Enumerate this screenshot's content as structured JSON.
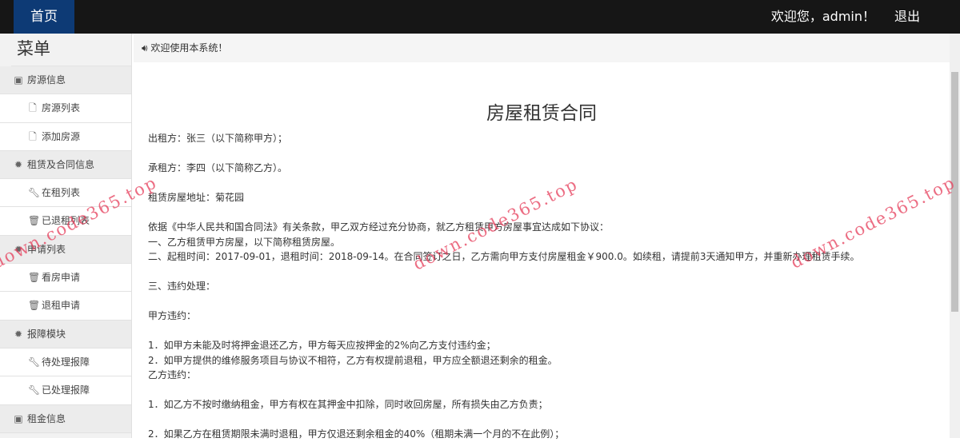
{
  "nav": {
    "home": "首页",
    "welcome": "欢迎您，admin！",
    "logout": "退出"
  },
  "sidebar": {
    "title": "菜单",
    "items": [
      {
        "label": "房源信息",
        "type": "grp",
        "icon": "book-icon"
      },
      {
        "label": "房源列表",
        "type": "sub",
        "icon": "file-icon"
      },
      {
        "label": "添加房源",
        "type": "sub",
        "icon": "file-icon"
      },
      {
        "label": "租赁及合同信息",
        "type": "grp",
        "icon": "gear-icon"
      },
      {
        "label": "在租列表",
        "type": "sub",
        "icon": "wrench-icon"
      },
      {
        "label": "已退租列表",
        "type": "sub",
        "icon": "trash-icon"
      },
      {
        "label": "申请列表",
        "type": "grp",
        "icon": "gear-icon"
      },
      {
        "label": "看房申请",
        "type": "sub",
        "icon": "trash-icon"
      },
      {
        "label": "退租申请",
        "type": "sub",
        "icon": "trash-icon"
      },
      {
        "label": "报障模块",
        "type": "grp",
        "icon": "gear-icon"
      },
      {
        "label": "待处理报障",
        "type": "sub",
        "icon": "wrench-icon"
      },
      {
        "label": "已处理报障",
        "type": "sub",
        "icon": "wrench-icon"
      },
      {
        "label": "租金信息",
        "type": "grp",
        "icon": "book-icon"
      }
    ]
  },
  "notice": "欢迎使用本系统！",
  "contract": {
    "title": "房屋租赁合同",
    "lines": [
      "出租方：张三（以下简称甲方）；",
      "",
      "承租方：李四（以下简称乙方）。",
      "",
      "租赁房屋地址：菊花园",
      "",
      "依据《中华人民共和国合同法》有关条款，甲乙双方经过充分协商，就乙方租赁甲方房屋事宜达成如下协议：",
      "一、乙方租赁甲方房屋，以下简称租赁房屋。",
      "二、起租时间：2017-09-01，退租时间：2018-09-14。在合同签订之日，乙方需向甲方支付房屋租金￥900.0。如续租，请提前3天通知甲方，并重新办理租赁手续。",
      "",
      "三、违约处理：",
      "",
      "甲方违约：",
      "",
      "1．如甲方未能及时将押金退还乙方，甲方每天应按押金的2%向乙方支付违约金；",
      "2．如甲方提供的维修服务项目与协议不相符，乙方有权提前退租，甲方应全额退还剩余的租金。",
      "乙方违约：",
      "",
      "1．如乙方不按时缴纳租金，甲方有权在其押金中扣除，同时收回房屋，所有损失由乙方负责；",
      "",
      "2．如果乙方在租赁期限未满时退租，甲方仅退还剩余租金的40%（租期未满一个月的不在此例）；"
    ]
  },
  "watermark": "down.code365.top"
}
